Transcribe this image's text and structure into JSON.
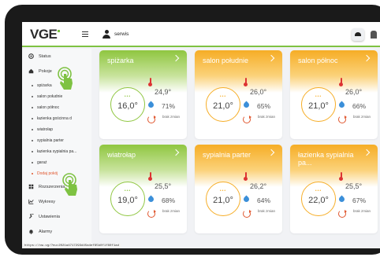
{
  "app": {
    "logo": "VGE",
    "user_name": "serwis"
  },
  "sidebar": {
    "status_label": "Status",
    "rooms_label": "Pokoje",
    "rooms": [
      "spiżarka",
      "salon południe",
      "salon północ",
      "łazienka gościnna d",
      "wiatrołap",
      "sypialnia parter",
      "łazienka sypialnia pa...",
      "garaż"
    ],
    "add_room_label": "Dodaj pokój",
    "extensions_label": "Rozszerzenia",
    "charts_label": "Wykresy",
    "settings_label": "Ustawienia",
    "alarms_label": "Alarmy"
  },
  "cards": [
    {
      "title": "spiżarka",
      "color": "green",
      "setpoint": "16,0°",
      "temp": "24,9°",
      "humidity": "71%",
      "status": "brak zmian"
    },
    {
      "title": "salon południe",
      "color": "orange",
      "setpoint": "21,0°",
      "temp": "26,0°",
      "humidity": "65%",
      "status": "brak zmian"
    },
    {
      "title": "salon północ",
      "color": "orange",
      "setpoint": "21,0°",
      "temp": "26,0°",
      "humidity": "66%",
      "status": "brak zmian"
    },
    {
      "title": "wiatrołap",
      "color": "green",
      "setpoint": "19,0°",
      "temp": "25,5°",
      "humidity": "68%",
      "status": "brak zmian"
    },
    {
      "title": "sypialnia parter",
      "color": "orange",
      "setpoint": "21,0°",
      "temp": "26,2°",
      "humidity": "64%",
      "status": "brak zmian"
    },
    {
      "title": "łazienka sypialnia pa...",
      "color": "orange",
      "setpoint": "22,0°",
      "temp": "25,5°",
      "humidity": "67%",
      "status": "brak zmian"
    }
  ],
  "colors": {
    "green": "#8fc640",
    "orange": "#f6ad26",
    "accent_red": "#e0562e",
    "humidity_blue": "#3b8fd9"
  },
  "statusbar_text": "https://ow.vg/?nu=2021a4717293d45a4ef85b0f1f80f1ad"
}
